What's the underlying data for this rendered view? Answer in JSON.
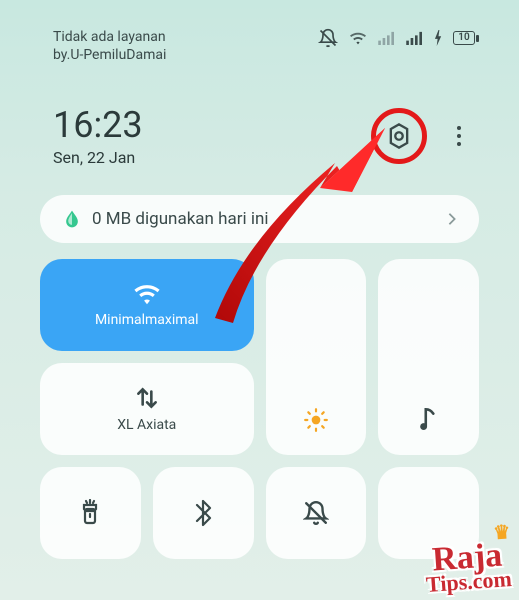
{
  "status_bar": {
    "no_service": "Tidak ada layanan",
    "subtitle": "by.U-PemiluDamai",
    "battery": "10"
  },
  "clock": {
    "time": "16:23",
    "date": "Sen, 22 Jan"
  },
  "data_usage": {
    "text": "0 MB digunakan hari ini"
  },
  "tiles": {
    "wifi": {
      "label": "Minimalmaximal"
    },
    "mobile_data": {
      "label": "XL Axiata"
    }
  },
  "watermark": {
    "line1": "Raja",
    "line2": "Tips.com"
  }
}
